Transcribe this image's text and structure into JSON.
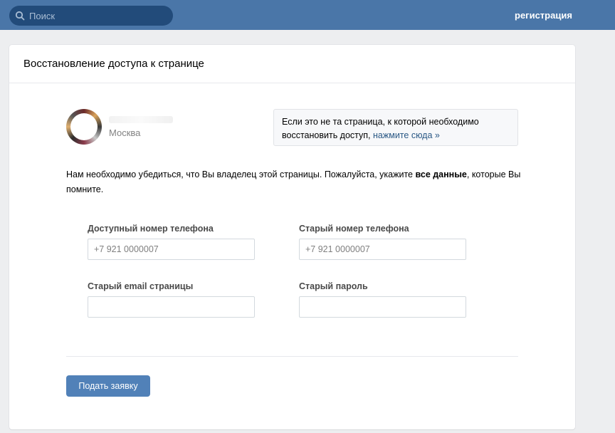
{
  "header": {
    "search_placeholder": "Поиск",
    "register_link": "регистрация"
  },
  "card": {
    "title": "Восстановление доступа к странице",
    "user": {
      "city": "Москва"
    },
    "hint": {
      "text": "Если это не та страница, к которой необходимо восстановить доступ,",
      "link": "нажмите сюда »"
    },
    "intro": {
      "text_before": "Нам необходимо убедиться, что Вы владелец этой страницы. Пожалуйста, укажите ",
      "bold": "все данные",
      "text_after": ", которые Вы помните."
    },
    "fields": {
      "phone_current": {
        "label": "Доступный номер телефона",
        "placeholder": "+7 921 0000007",
        "value": ""
      },
      "phone_old": {
        "label": "Старый номер телефона",
        "placeholder": "+7 921 0000007",
        "value": ""
      },
      "email_old": {
        "label": "Старый email страницы",
        "placeholder": "",
        "value": ""
      },
      "password_old": {
        "label": "Старый пароль",
        "placeholder": "",
        "value": ""
      }
    },
    "submit_label": "Подать заявку"
  },
  "colors": {
    "topbar": "#4a76a8",
    "search_bg": "#224b7a",
    "button": "#5181b8",
    "link": "#2a5885",
    "page_bg": "#edeef0"
  }
}
